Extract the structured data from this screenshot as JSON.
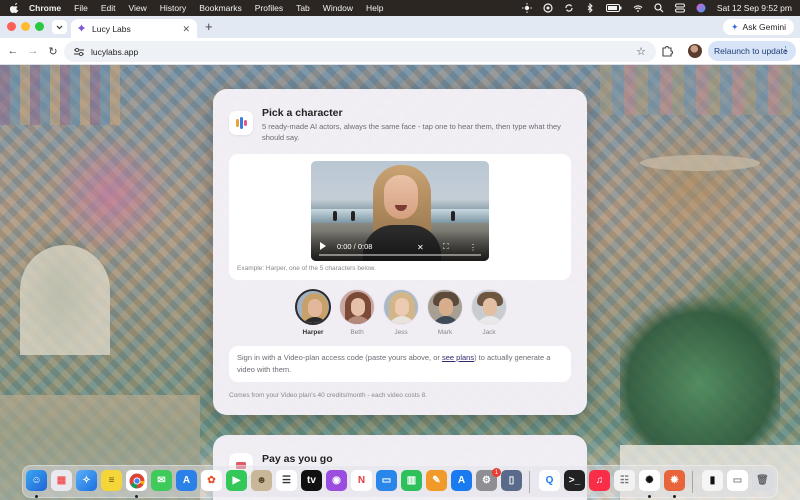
{
  "menubar": {
    "app": "Chrome",
    "items": [
      "File",
      "Edit",
      "View",
      "History",
      "Bookmarks",
      "Profiles",
      "Tab",
      "Window",
      "Help"
    ],
    "clock": "Sat 12 Sep  9:52 pm"
  },
  "browser": {
    "tab_title": "Lucy Labs",
    "url": "lucylabs.app",
    "gemini_label": "Ask Gemini",
    "relaunch_label": "Relaunch to update"
  },
  "card": {
    "title": "Pick a character",
    "description": "5 ready-made AI actors, always the same face - tap one to hear them, then type what they should say.",
    "video_time": "0:00 / 0:08",
    "video_caption": "Example: Harper, one of the 5 characters below.",
    "characters": [
      {
        "name": "Harper",
        "selected": true
      },
      {
        "name": "Beth",
        "selected": false
      },
      {
        "name": "Jess",
        "selected": false
      },
      {
        "name": "Mark",
        "selected": false
      },
      {
        "name": "Jack",
        "selected": false
      }
    ],
    "signin_before": "Sign in with a Video-plan access code (paste yours above, or ",
    "signin_link": "see plans",
    "signin_after": ") to actually generate a video with them.",
    "footnote": "Comes from your Video plan's 40 credits/month - each video costs 8."
  },
  "card2": {
    "title": "Pay as you go"
  },
  "dock": {
    "badge_count": "1"
  }
}
